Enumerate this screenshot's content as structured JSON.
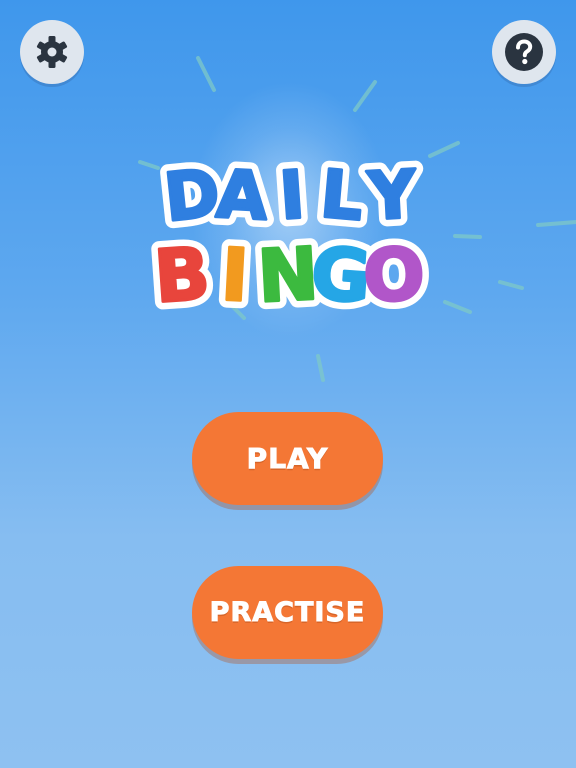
{
  "header": {
    "settings_icon": "gear-icon",
    "help_icon": "question-mark-icon"
  },
  "logo": {
    "line1": [
      "D",
      "A",
      "I",
      "L",
      "Y"
    ],
    "line2": [
      "B",
      "I",
      "N",
      "G",
      "O"
    ],
    "line1_color": "#2f7fe0",
    "line2_colors": [
      "#e8453c",
      "#f29a1f",
      "#3cba3f",
      "#25a6e6",
      "#b156c9"
    ]
  },
  "menu": {
    "play_label": "PLAY",
    "practise_label": "PRACTISE"
  },
  "colors": {
    "button_orange": "#f47735",
    "icon_dark": "#2a3440",
    "icon_bg": "#dfe6ee"
  }
}
